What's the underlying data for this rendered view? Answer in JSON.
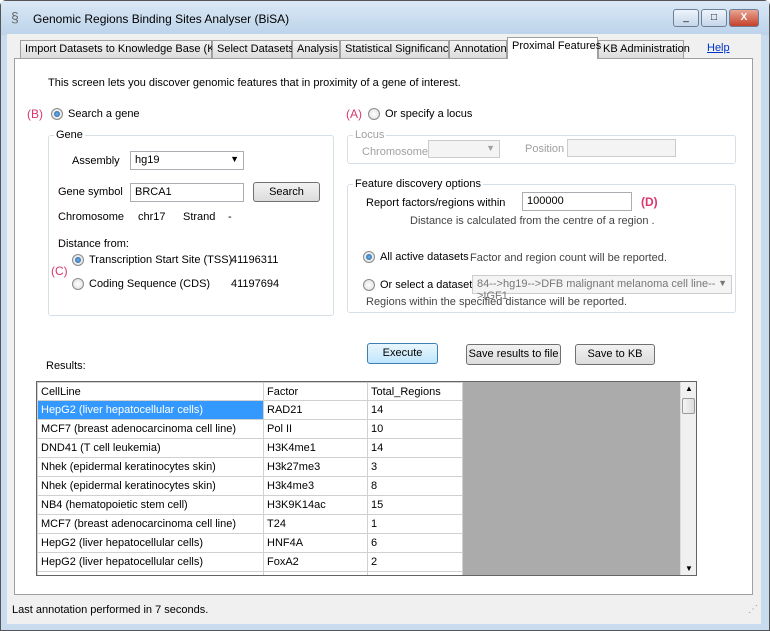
{
  "window": {
    "title": "Genomic Regions Binding Sites Analyser (BiSA)",
    "minimize": "_",
    "maximize": "□",
    "close": "X"
  },
  "tabs": [
    {
      "label": "Import Datasets to Knowledge Base (KB)"
    },
    {
      "label": "Select Datasets"
    },
    {
      "label": "Analysis"
    },
    {
      "label": "Statistical Significance"
    },
    {
      "label": "Annotation"
    },
    {
      "label": "Proximal Features",
      "selected": true
    },
    {
      "label": "KB Administration"
    }
  ],
  "help": "Help",
  "intro": "This screen lets you discover genomic features that in proximity of a gene of interest.",
  "annotations": {
    "b": "(B)",
    "a": "(A)",
    "c": "(C)",
    "d": "(D)"
  },
  "mode": {
    "search_gene": "Search a gene",
    "specify_locus": "Or specify a locus",
    "selected": "search_gene"
  },
  "gene": {
    "legend": "Gene",
    "assembly_label": "Assembly",
    "assembly_value": "hg19",
    "symbol_label": "Gene symbol",
    "symbol_value": "BRCA1",
    "search_button": "Search",
    "chromosome_label": "Chromosome",
    "chromosome_value": "chr17",
    "strand_label": "Strand",
    "strand_value": "-",
    "distance_label": "Distance from:",
    "tss_label": "Transcription Start Site (TSS)",
    "tss_value": "41196311",
    "cds_label": "Coding Sequence (CDS)",
    "cds_value": "41197694",
    "distance_selected": "tss"
  },
  "locus": {
    "legend": "Locus",
    "chromosome_label": "Chromosome",
    "chromosome_value": "",
    "position_label": "Position",
    "position_value": ""
  },
  "feature": {
    "legend": "Feature discovery options",
    "report_label": "Report factors/regions within",
    "report_value": "100000",
    "distance_note": "Distance is calculated from the centre of a region .",
    "all_label": "All active datasets",
    "all_note": "Factor and region count will be reported.",
    "select_label": "Or select a dataset",
    "dataset_value": "84-->hg19-->DFB malignant melanoma cell line-->IGF1",
    "select_note": "Regions within the specified distance will be reported.",
    "selected": "all"
  },
  "buttons": {
    "execute": "Execute",
    "save_file": "Save results to file",
    "save_kb": "Save to KB"
  },
  "results": {
    "label": "Results:",
    "columns": [
      "CellLine",
      "Factor",
      "Total_Regions"
    ],
    "rows": [
      [
        "HepG2 (liver hepatocellular cells)",
        "RAD21",
        "14"
      ],
      [
        "MCF7 (breast adenocarcinoma cell line)",
        "Pol II",
        "10"
      ],
      [
        "DND41 (T cell leukemia)",
        "H3K4me1",
        "14"
      ],
      [
        "Nhek (epidermal keratinocytes skin)",
        "H3k27me3",
        "3"
      ],
      [
        "Nhek (epidermal keratinocytes skin)",
        "H3k4me3",
        "8"
      ],
      [
        "NB4 (hematopoietic stem cell)",
        "H3K9K14ac",
        "15"
      ],
      [
        "MCF7 (breast adenocarcinoma cell line)",
        "T24",
        "1"
      ],
      [
        "HepG2 (liver hepatocellular cells)",
        "HNF4A",
        "6"
      ],
      [
        "HepG2 (liver hepatocellular cells)",
        "FoxA2",
        "2"
      ]
    ]
  },
  "status": "Last annotation performed in 7 seconds."
}
